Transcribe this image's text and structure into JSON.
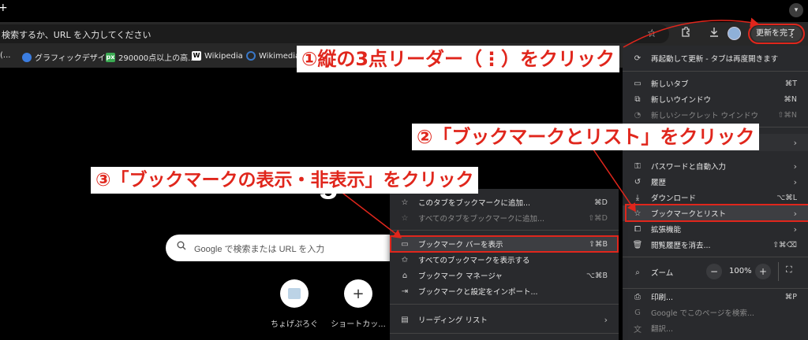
{
  "browser": {
    "new_tab_icon": "plus-icon",
    "tab_search_icon": "chevron-down-icon",
    "omnibox_text": "検索するか、URL を入力してください",
    "update_button_label": "更新を完了",
    "menu_icon": "vertical-dots-icon"
  },
  "bookmarks": [
    {
      "label": "(...",
      "icon": "folder-icon"
    },
    {
      "label": "グラフィックデザイ...",
      "icon": "globe-icon"
    },
    {
      "label": "290000点以上の高...",
      "icon": "px-icon",
      "badge": "px"
    },
    {
      "label": "Wikipedia",
      "icon": "wikipedia-icon",
      "badge": "W"
    },
    {
      "label": "Wikimedia C",
      "icon": "wikimedia-icon"
    }
  ],
  "page": {
    "logo": "Google",
    "search_placeholder": "Google で検索または URL を入力",
    "shortcuts": [
      {
        "label": "ちょげぷろぐ"
      },
      {
        "label": "ショートカッ..."
      }
    ]
  },
  "main_menu": {
    "relaunch": "再起動して更新 - タブは再度開きます",
    "items": [
      {
        "label": "新しいタブ",
        "shortcut": "⌘T"
      },
      {
        "label": "新しいウインドウ",
        "shortcut": "⌘N"
      },
      {
        "label": "新しいシークレット ウインドウ",
        "shortcut": "⇧⌘N"
      },
      {
        "label": "パスワードと自動入力"
      },
      {
        "label": "履歴"
      },
      {
        "label": "ダウンロード",
        "shortcut": "⌥⌘L"
      },
      {
        "label": "ブックマークとリスト"
      },
      {
        "label": "拡張機能"
      },
      {
        "label": "閲覧履歴を消去...",
        "shortcut": "⇧⌘⌫"
      },
      {
        "label": "ズーム"
      },
      {
        "label": "印刷...",
        "shortcut": "⌘P"
      },
      {
        "label": "Google でこのページを検索..."
      },
      {
        "label": "翻訳..."
      }
    ],
    "zoom_minus": "−",
    "zoom_value": "100%",
    "zoom_plus": "+"
  },
  "bookmark_submenu": {
    "items": [
      {
        "label": "このタブをブックマークに追加...",
        "shortcut": "⌘D"
      },
      {
        "label": "すべてのタブをブックマークに追加...",
        "shortcut": "⇧⌘D"
      },
      {
        "label": "ブックマーク バーを表示",
        "shortcut": "⇧⌘B"
      },
      {
        "label": "すべてのブックマークを表示する"
      },
      {
        "label": "ブックマーク マネージャ",
        "shortcut": "⌥⌘B"
      },
      {
        "label": "ブックマークと設定をインポート..."
      },
      {
        "label": "リーディング リスト"
      }
    ]
  },
  "annotations": {
    "step1": "①縦の3点リーダー（⋮）をクリック",
    "step2": "②「ブックマークとリスト」をクリック",
    "step3": "③「ブックマークの表示・非表示」をクリック",
    "color": "#e0261c"
  }
}
